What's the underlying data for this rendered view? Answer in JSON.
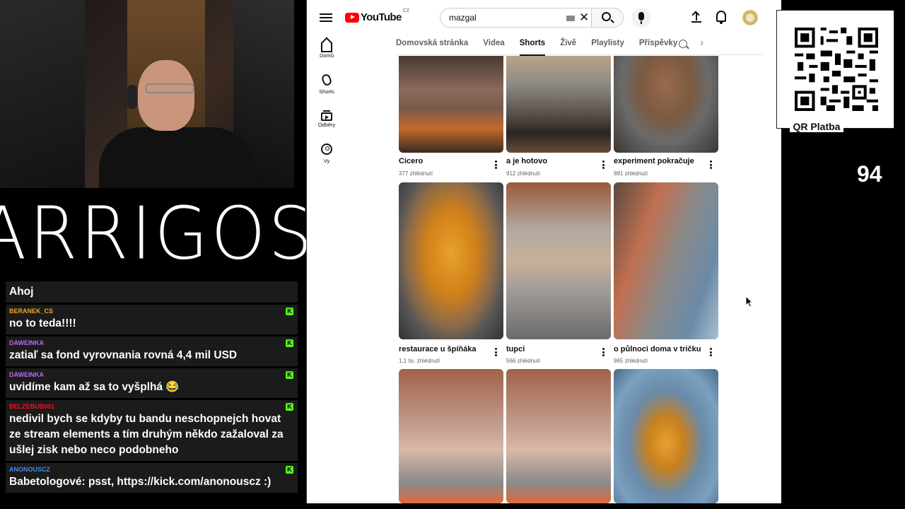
{
  "stream": {
    "logo_text": "ARRIGOS",
    "viewer_count": "94",
    "qr_label": "QR Platba"
  },
  "chat": {
    "messages": [
      {
        "user": "",
        "color": "#ffffff",
        "text": "Ahoj"
      },
      {
        "user": "BERANEK_CS",
        "color": "#f5a623",
        "text": "no to teda!!!!"
      },
      {
        "user": "DAWEINKA",
        "color": "#b86bf0",
        "text": "zatiaľ sa fond vyrovnania rovná 4,4 mil USD"
      },
      {
        "user": "DAWEINKA",
        "color": "#b86bf0",
        "text": "uvidíme kam až sa to vyšplhá 😂"
      },
      {
        "user": "BELZEBUB001",
        "color": "#d91a2a",
        "text": "nedivil bych se kdyby tu bandu neschopnejch hovat ze stream elements a tím druhým někdo zažaloval za ušlej zisk nebo neco podobneho"
      },
      {
        "user": "ANONOUSCZ",
        "color": "#3b8de8",
        "text": "Babetologové: psst, https://kick.com/anonouscz :)"
      }
    ]
  },
  "youtube": {
    "logo_text": "YouTube",
    "country_code": "CZ",
    "search_value": "mazgal",
    "sidebar": [
      {
        "label": "Domů",
        "icon": "home-icon"
      },
      {
        "label": "Shorts",
        "icon": "shorts-icon"
      },
      {
        "label": "Odběry",
        "icon": "subscriptions-icon"
      },
      {
        "label": "Vy",
        "icon": "you-icon"
      }
    ],
    "tabs": [
      "Domovská stránka",
      "Videa",
      "Shorts",
      "Živě",
      "Playlisty",
      "Příspěvky"
    ],
    "active_tab": "Shorts",
    "shorts": [
      {
        "title": "Cicero",
        "views": "377 zhlédnutí"
      },
      {
        "title": "a je hotovo",
        "views": "912 zhlédnutí"
      },
      {
        "title": "experiment pokračuje",
        "views": "891 zhlédnutí"
      },
      {
        "title": "restaurace u špíňáka",
        "views": "1,1 tis. zhlédnutí"
      },
      {
        "title": "tupci",
        "views": "566 zhlédnutí"
      },
      {
        "title": "o půlnoci doma v tričku",
        "views": "965 zhlédnutí"
      },
      {
        "title": "",
        "views": ""
      },
      {
        "title": "",
        "views": ""
      },
      {
        "title": "",
        "views": ""
      }
    ]
  }
}
